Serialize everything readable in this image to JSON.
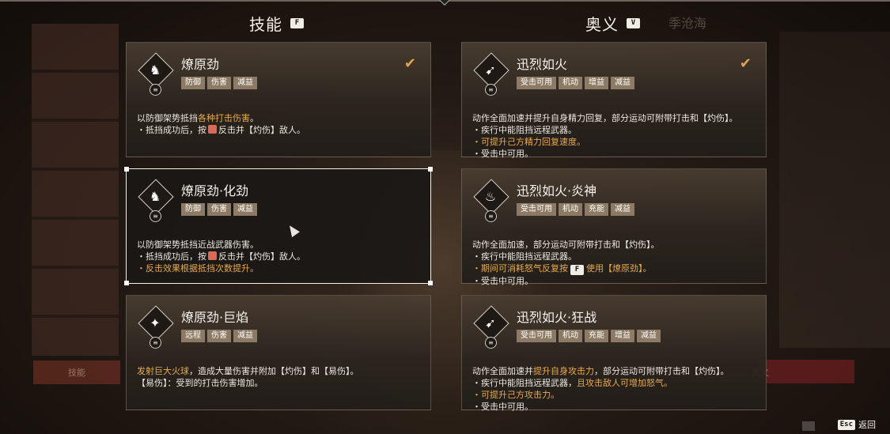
{
  "skills_header": {
    "title": "技能",
    "key": "F"
  },
  "ultimate_header": {
    "title": "奥义",
    "key": "V"
  },
  "background_name": "季沧海",
  "background_btn_left": "技能",
  "background_btn_right": "奥义",
  "skills": [
    {
      "name": "燎原劲",
      "tags": [
        "防御",
        "伤害",
        "减益"
      ],
      "equipped": true,
      "selected": false,
      "glyph": "♞",
      "lines": [
        [
          {
            "t": "以防御架势抵挡"
          },
          {
            "t": "各种打击伤害",
            "c": "gold"
          },
          {
            "t": "。"
          }
        ],
        [
          {
            "t": "・抵挡成功后，按"
          },
          {
            "icon": "mouse-button"
          },
          {
            "t": "反击并【灼伤】敌人。"
          }
        ]
      ]
    },
    {
      "name": "燎原劲·化劲",
      "tags": [
        "防御",
        "伤害",
        "减益"
      ],
      "equipped": false,
      "selected": true,
      "glyph": "♞",
      "lines": [
        [
          {
            "t": "以防御架势抵挡近战武器伤害。"
          }
        ],
        [
          {
            "t": "・抵挡成功后，按"
          },
          {
            "icon": "mouse-button"
          },
          {
            "t": "反击并【灼伤】敌人。"
          }
        ],
        [
          {
            "t": "・反击效果根据抵挡次数提升。",
            "c": "gold"
          }
        ]
      ]
    },
    {
      "name": "燎原劲·巨焰",
      "tags": [
        "远程",
        "伤害",
        "减益"
      ],
      "equipped": false,
      "selected": false,
      "glyph": "✦",
      "lines": [
        [
          {
            "t": "发射巨大火球",
            "c": "gold"
          },
          {
            "t": "，造成大量伤害并附加【灼伤】和【易伤】。"
          }
        ],
        [
          {
            "t": "【易伤】：受到的打击伤害增加。"
          }
        ]
      ]
    }
  ],
  "ultimates": [
    {
      "name": "迅烈如火",
      "tags": [
        "受击可用",
        "机动",
        "增益",
        "减益"
      ],
      "equipped": true,
      "selected": false,
      "glyph": "➹",
      "lines": [
        [
          {
            "t": "动作全面加速并提升自身精力回复，部分运动可附带打击和【灼伤】。"
          }
        ],
        [
          {
            "t": "・疾行中能阻挡远程武器。"
          }
        ],
        [
          {
            "t": "・可提升己方精力回复速度。",
            "c": "gold"
          }
        ],
        [
          {
            "t": "・受击中可用。"
          }
        ]
      ]
    },
    {
      "name": "迅烈如火·炎神",
      "tags": [
        "受击可用",
        "机动",
        "充能",
        "减益"
      ],
      "equipped": false,
      "selected": false,
      "glyph": "♨",
      "lines": [
        [
          {
            "t": "动作全面加速，部分运动可附带打击和【灼伤】。"
          }
        ],
        [
          {
            "t": "・疾行中能阻挡远程武器。"
          }
        ],
        [
          {
            "t": "・期间可消耗怒气反复按",
            "c": "gold"
          },
          {
            "key": "F"
          },
          {
            "t": "使用【燎原劲】。",
            "c": "gold"
          }
        ],
        [
          {
            "t": "・受击中可用。"
          }
        ]
      ]
    },
    {
      "name": "迅烈如火·狂战",
      "tags": [
        "受击可用",
        "机动",
        "充能",
        "增益",
        "减益"
      ],
      "equipped": false,
      "selected": false,
      "glyph": "➹",
      "lines": [
        [
          {
            "t": "动作全面加速并"
          },
          {
            "t": "提升自身攻击力",
            "c": "gold"
          },
          {
            "t": "，部分运动可附带打击和【灼伤】。"
          }
        ],
        [
          {
            "t": "・疾行中能阻挡远程武器，"
          },
          {
            "t": "且攻击敌人可增加怒气。",
            "c": "gold"
          }
        ],
        [
          {
            "t": "・可提升己方攻击力。",
            "c": "gold"
          }
        ],
        [
          {
            "t": "・受击中可用。"
          }
        ]
      ]
    }
  ],
  "footer": {
    "key": "Esc",
    "label": "返回"
  },
  "colors": {
    "accent_gold": "#e7aa4b",
    "tag_bg": "#8c7a64",
    "check": "#e0a352"
  }
}
